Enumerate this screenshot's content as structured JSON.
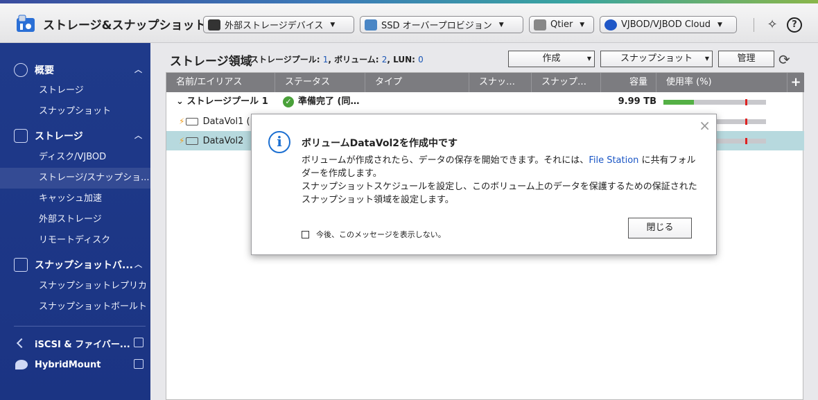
{
  "app": {
    "title": "ストレージ&スナップショット"
  },
  "toolbar": {
    "external_device": "外部ストレージデバイス",
    "ssd_overprovision": "SSD オーバープロビジョン",
    "qtier": "Qtier",
    "vjbod": "VJBOD/VJBOD Cloud"
  },
  "sidebar": {
    "overview": {
      "label": "概要",
      "items": [
        "ストレージ",
        "スナップショット"
      ]
    },
    "storage": {
      "label": "ストレージ",
      "items": [
        "ディスク/VJBOD",
        "ストレージ/スナップショ...",
        "キャッシュ加速",
        "外部ストレージ",
        "リモートディスク"
      ]
    },
    "snapshot_backup": {
      "label": "スナップショットバ...",
      "items": [
        "スナップショットレプリカ",
        "スナップショットボールト"
      ]
    },
    "iscsi": "iSCSI & ファイバー...",
    "hybridmount": "HybridMount"
  },
  "main": {
    "title": "ストレージ領域",
    "summary": {
      "pool_label": "ストレージプール: ",
      "pool_count": "1",
      "volume_label": ", ボリューム: ",
      "volume_count": "2",
      "lun_label": ", LUN: ",
      "lun_count": "0"
    },
    "buttons": {
      "create": "作成",
      "snapshot": "スナップショット",
      "manage": "管理"
    },
    "columns": [
      "名前/エイリアス",
      "ステータス",
      "タイプ",
      "スナッ…",
      "スナップ…",
      "容量",
      "使用率 (%)"
    ],
    "rows": [
      {
        "name": "ストレージプール 1",
        "status": "準備完了 (同…",
        "capacity": "9.99 TB",
        "usage_pct": 30,
        "threshold_pct": 80
      },
      {
        "name": "DataVol1 (シ",
        "usage_pct": 0,
        "threshold_pct": 80
      },
      {
        "name": "DataVol2",
        "usage_pct": 0,
        "threshold_pct": 80
      }
    ]
  },
  "modal": {
    "title": "ボリュームDataVol2を作成中です",
    "line1_a": "ボリュームが作成されたら、データの保存を開始できます。それには、",
    "line1_link": "File Station",
    "line1_b": " に共有フォルダーを作成します。",
    "line2": "スナップショットスケジュールを設定し、このボリューム上のデータを保護するための保証されたスナップショット領域を設定します。",
    "dont_show": "今後、このメッセージを表示しない。",
    "close": "閉じる"
  }
}
